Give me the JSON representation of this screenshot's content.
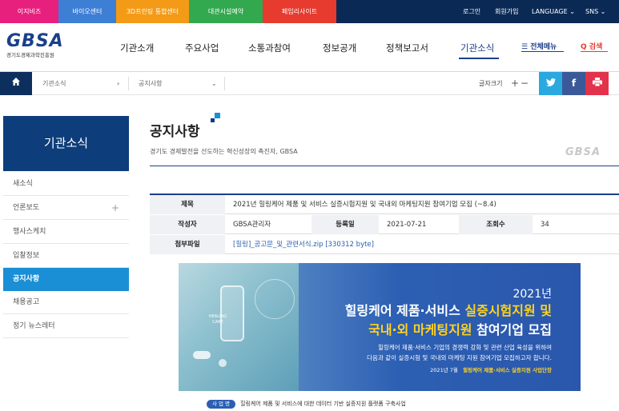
{
  "topbar": {
    "quick_links": [
      "이지비즈",
      "바이오센터",
      "3D프린팅 통합센터",
      "대관시설예약",
      "페임리사이트"
    ],
    "utility": {
      "login": "로그인",
      "join": "회원가입",
      "language": "LANGUAGE ⌄",
      "sns": "SNS ⌄"
    }
  },
  "header": {
    "logo_mark": "GBSA",
    "logo_sub": "경기도경제과학진흥원",
    "nav": [
      "기관소개",
      "주요사업",
      "소통과참여",
      "정보공개",
      "정책보고서",
      "기관소식"
    ],
    "active_nav": "기관소식",
    "all_menu": "☰ 전체메뉴",
    "search": "Q 검색"
  },
  "breadcrumb": {
    "home_icon": "home-icon",
    "level1": "기관소식",
    "level1_arrow": "›",
    "level2": "공지사항",
    "level2_arrow": "⌄",
    "font_size_label": "글자크기",
    "font_plus": "+",
    "font_minus": "−",
    "share": {
      "twitter": "t",
      "facebook": "f",
      "print": "⎙"
    }
  },
  "sidebar": {
    "title": "기관소식",
    "items": [
      {
        "label": "새소식"
      },
      {
        "label": "언론보도",
        "expand": "+"
      },
      {
        "label": "행사스케치"
      },
      {
        "label": "입찰정보"
      },
      {
        "label": "공지사항",
        "active": true
      },
      {
        "label": "채용공고"
      },
      {
        "label": "정기 뉴스레터"
      }
    ]
  },
  "page": {
    "title": "공지사항",
    "subtitle": "경기도 경제발전을 선도하는 혁신성장의 촉진자, GBSA",
    "watermark": "GBSA"
  },
  "notice": {
    "title_label": "제목",
    "title_value": "2021년 힐링케어 제품 및 서비스 실증시험지원 및 국내외 마케팅지원 참여기업 모집 (~8.4)",
    "author_label": "작성자",
    "author_value": "GBSA관리자",
    "date_label": "등록일",
    "date_value": "2021-07-21",
    "views_label": "조회수",
    "views_value": "34",
    "attach_label": "첨부파일",
    "attach_value": "[힐링]_공고문_및_관련서식.zip [330312 byte]"
  },
  "banner": {
    "photo_label": "HEALING CARE",
    "year": "2021년",
    "line1_pre": "힐링케어 제품·서비스 ",
    "line1_hl": "실증시험지원 및",
    "line2_hl": "국내·외 마케팅지원",
    "line2_post": " 참여기업 모집",
    "desc1": "힐링케어 제품·서비스 기업의 경쟁력 강화 및 관련 산업 육성을 위하여",
    "desc2": "다음과 같이 실증시험 및 국내외 마케팅 지원 참여기업 모집하고자 합니다.",
    "foot_date": "2021년 7월",
    "foot_org": "힐링케어 제품·서비스 실증지원 사업단장",
    "highlight_color": "#ffd21f"
  },
  "caption": {
    "badge": "사 업 명",
    "text": "힐링케어 제품 및 서비스에 대한 데이터 기반 실증지원 플랫폼 구축사업"
  }
}
